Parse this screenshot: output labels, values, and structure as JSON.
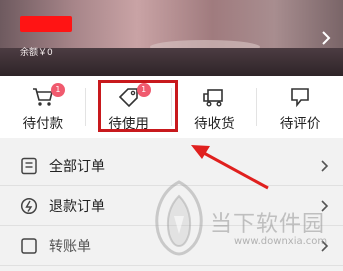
{
  "header": {
    "balance_text": "余额￥0"
  },
  "status_tabs": [
    {
      "label": "待付款",
      "icon": "shopping-cart-icon",
      "badge": "1"
    },
    {
      "label": "待使用",
      "icon": "tag-icon",
      "badge": "1"
    },
    {
      "label": "待收货",
      "icon": "delivery-truck-icon",
      "badge": ""
    },
    {
      "label": "待评价",
      "icon": "comment-icon",
      "badge": ""
    }
  ],
  "list": [
    {
      "label": "全部订单",
      "icon": "document-icon"
    },
    {
      "label": "退款订单",
      "icon": "refund-icon"
    },
    {
      "label": "转账单",
      "icon": "transfer-icon"
    }
  ],
  "watermark": {
    "title": "当下软件园",
    "url": "www.downxia.com"
  },
  "colors": {
    "highlight": "#c8191d",
    "badge": "#f05a6e",
    "redaction": "#ff1414"
  }
}
